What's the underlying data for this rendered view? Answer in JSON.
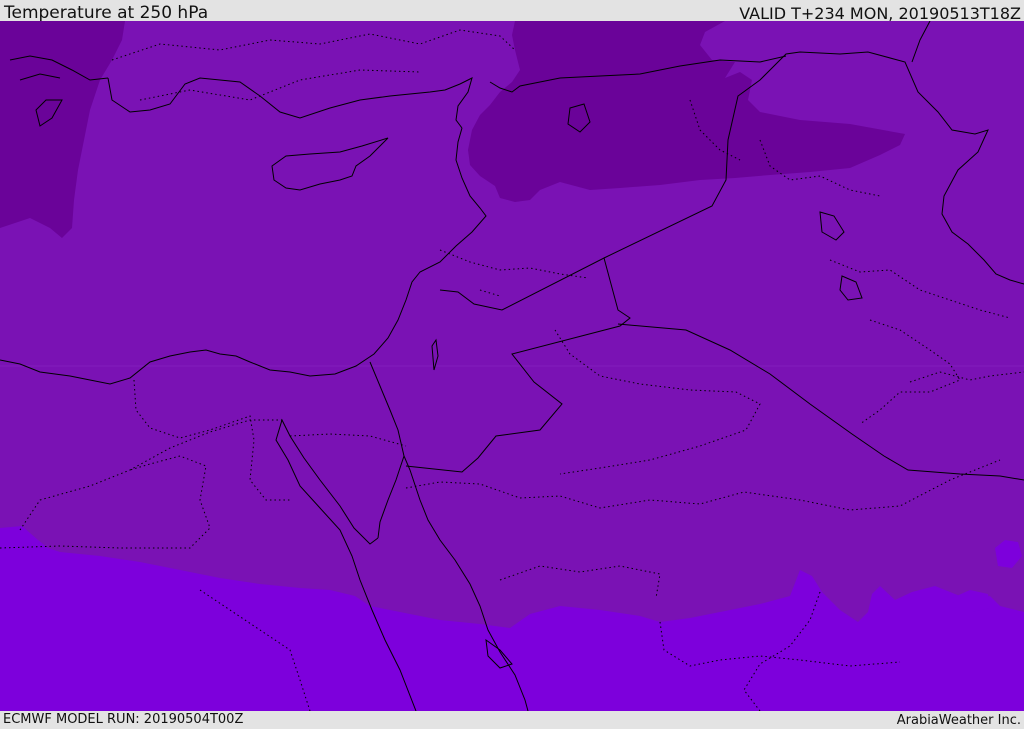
{
  "header": {
    "title": "Temperature at 250 hPa",
    "valid": "VALID T+234 MON, 20190513T18Z"
  },
  "footer": {
    "model_run": "ECMWF MODEL RUN: 20190504T00Z",
    "credit": "ArabiaWeather Inc."
  },
  "colors": {
    "background_band": "#7a12b4",
    "cold_zone": "#6a0399",
    "warm_zone": "#7d00dc",
    "coastline": "#000000",
    "header_bar": "#e3e3e3"
  },
  "map": {
    "variable": "Temperature",
    "level": "250 hPa",
    "region": "Eastern Mediterranean and Middle East"
  }
}
